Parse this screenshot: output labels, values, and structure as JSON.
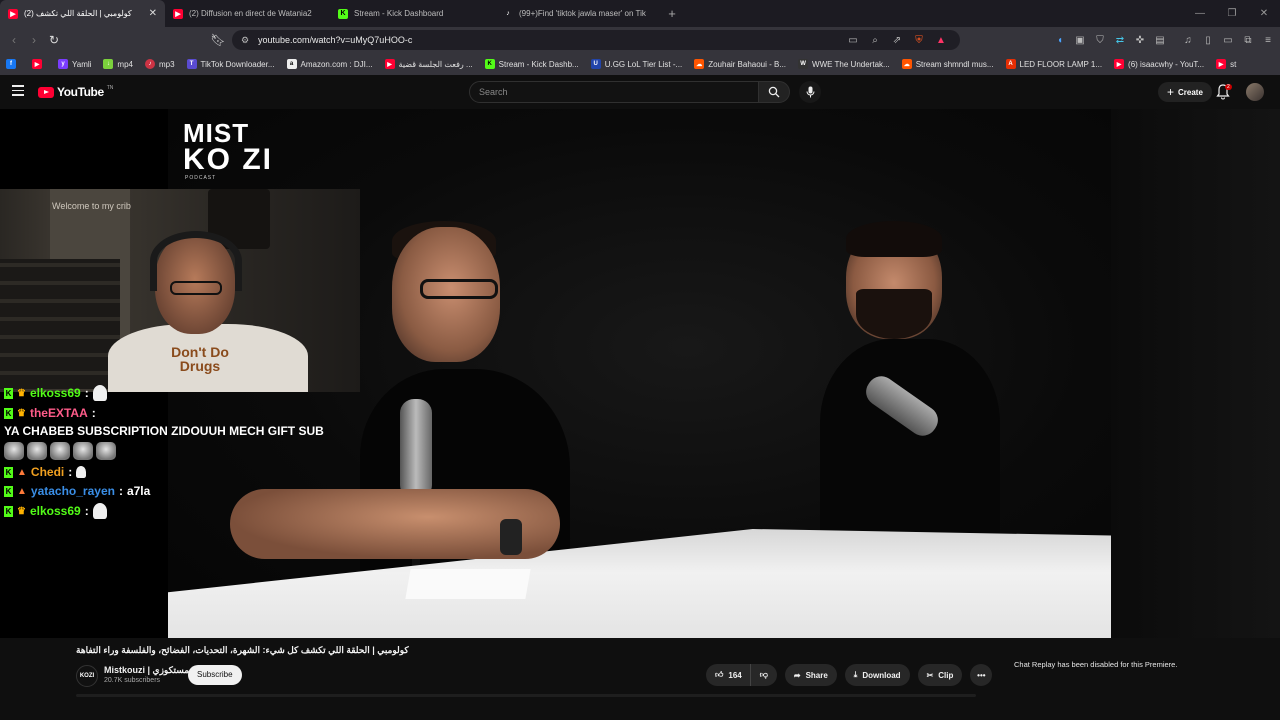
{
  "browser": {
    "tabs": [
      {
        "title": "كولومبي | الحلقة اللي تكشف (2)",
        "active": true,
        "favicon": "youtube-icon",
        "color": "#ff0033"
      },
      {
        "title": "(2) Diffusion en direct de Watania2",
        "active": false,
        "favicon": "youtube-icon",
        "color": "#ff0033"
      },
      {
        "title": "Stream - Kick Dashboard",
        "active": false,
        "favicon": "kick-icon",
        "color": "#53fc18"
      },
      {
        "title": "(99+)Find 'tiktok jawla maser' on Tik",
        "active": false,
        "favicon": "tiktok-icon",
        "color": "#ffffff"
      }
    ],
    "url": "youtube.com/watch?v=uMyQ7uHOO-c",
    "bookmarks": [
      {
        "label": "",
        "favicon": "facebook-icon",
        "color": "#1877f2"
      },
      {
        "label": "",
        "favicon": "youtube-icon",
        "color": "#ff0033"
      },
      {
        "label": "Yamli",
        "favicon": "yamli-icon",
        "color": "#7a3cff"
      },
      {
        "label": "mp4",
        "favicon": "download-icon",
        "color": "#7bd13c"
      },
      {
        "label": "mp3",
        "favicon": "music-icon",
        "color": "#cc3344"
      },
      {
        "label": "TikTok Downloader...",
        "favicon": "tiktok-icon",
        "color": "#5a4bd1"
      },
      {
        "label": "Amazon.com : DJI...",
        "favicon": "amazon-icon",
        "color": "#444444"
      },
      {
        "label": "رفعت الجلسة قضية ...",
        "favicon": "youtube-icon",
        "color": "#ff0033"
      },
      {
        "label": "Stream - Kick Dashb...",
        "favicon": "kick-icon",
        "color": "#53fc18"
      },
      {
        "label": "U.GG LoL Tier List -...",
        "favicon": "ugg-icon",
        "color": "#2244aa"
      },
      {
        "label": "Zouhair Bahaoui - B...",
        "favicon": "soundcloud-icon",
        "color": "#ff5500"
      },
      {
        "label": "WWE The Undertak...",
        "favicon": "wwe-icon",
        "color": "#333333"
      },
      {
        "label": "Stream shmndl mus...",
        "favicon": "soundcloud-icon",
        "color": "#ff5500"
      },
      {
        "label": "LED FLOOR LAMP 1...",
        "favicon": "aliexpress-icon",
        "color": "#e62e04"
      },
      {
        "label": "(6) isaacwhy - YouT...",
        "favicon": "youtube-icon",
        "color": "#ff0033"
      },
      {
        "label": "st",
        "favicon": "youtube-icon",
        "color": "#ff0033"
      }
    ]
  },
  "youtube": {
    "logo_text": "YouTube",
    "logo_tm": "TN",
    "search_placeholder": "Search",
    "create_label": "Create",
    "notification_count": "2"
  },
  "video": {
    "overlay_logo": {
      "line1": "MIST",
      "line2": "KO  ZI",
      "line3": "PODCAST"
    },
    "webcam": {
      "wall_text": "Welcome to my crib",
      "shirt_text": "Don't Do Drugs"
    },
    "chat": [
      {
        "user": "elkoss69",
        "user_color": "#53fc18",
        "badge": "crown",
        "message": "",
        "emote": "ghost"
      },
      {
        "user": "theEXTAA",
        "user_color": "#ff5c8a",
        "badge": "crown",
        "message": "YA CHABEB SUBSCRIPTION ZIDOUUH MECH GIFT SUB",
        "emote": "cat-x5"
      },
      {
        "user": "Chedi",
        "user_color": "#f0a020",
        "badge": "hat",
        "message": "",
        "emote": "ghost-small"
      },
      {
        "user": "yatacho_rayen",
        "user_color": "#3a8ee6",
        "badge": "hat",
        "message": "a7la",
        "emote": ""
      },
      {
        "user": "elkoss69",
        "user_color": "#53fc18",
        "badge": "crown",
        "message": "",
        "emote": "ghost"
      }
    ]
  },
  "meta": {
    "title": "كولومبي | الحلقة اللي تكشف كل شيء: الشهرة، التحديات، الفضائح، والفلسفة وراء التفاهة",
    "channel_name": "Mistkouzi | مستكوزي",
    "channel_avatar_text": "KOZI",
    "subscribers": "20.7K subscribers",
    "subscribe_label": "Subscribe",
    "likes": "164",
    "share_label": "Share",
    "download_label": "Download",
    "clip_label": "Clip",
    "chat_replay_note": "Chat Replay has been disabled for this Premiere."
  }
}
